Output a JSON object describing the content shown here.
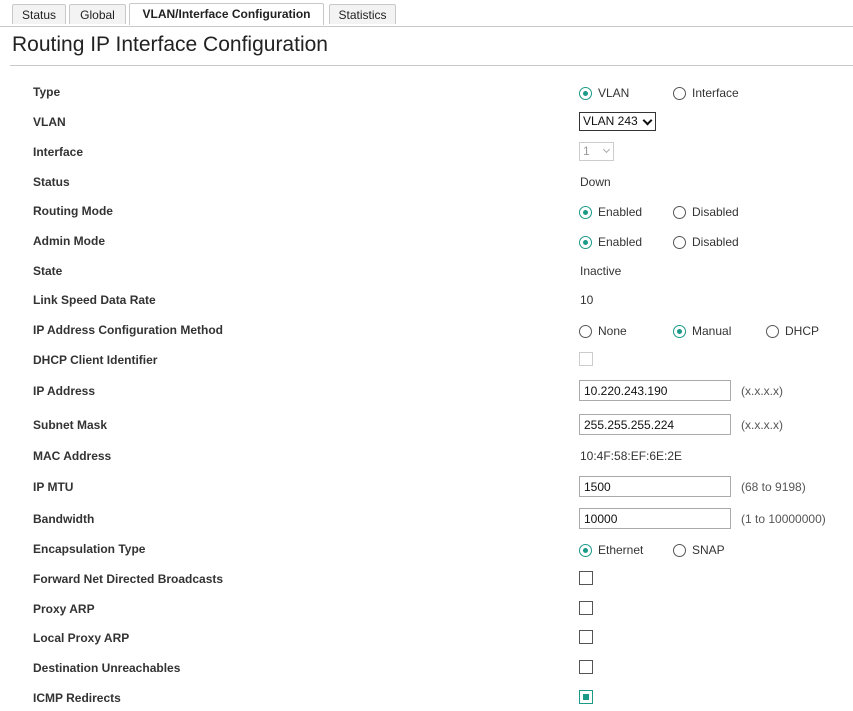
{
  "tabs": [
    "Status",
    "Global",
    "VLAN/Interface Configuration",
    "Statistics"
  ],
  "page_title": "Routing IP Interface Configuration",
  "fields": {
    "type": {
      "label": "Type",
      "options": [
        "VLAN",
        "Interface"
      ],
      "selected": "VLAN"
    },
    "vlan": {
      "label": "VLAN",
      "value": "VLAN 243"
    },
    "interface": {
      "label": "Interface",
      "value": "1"
    },
    "status": {
      "label": "Status",
      "value": "Down"
    },
    "routing_mode": {
      "label": "Routing Mode",
      "options": [
        "Enabled",
        "Disabled"
      ],
      "selected": "Enabled"
    },
    "admin_mode": {
      "label": "Admin Mode",
      "options": [
        "Enabled",
        "Disabled"
      ],
      "selected": "Enabled"
    },
    "state": {
      "label": "State",
      "value": "Inactive"
    },
    "link_speed": {
      "label": "Link Speed Data Rate",
      "value": "10"
    },
    "ip_method": {
      "label": "IP Address Configuration Method",
      "options": [
        "None",
        "Manual",
        "DHCP"
      ],
      "selected": "Manual"
    },
    "dhcp_client_id": {
      "label": "DHCP Client Identifier",
      "checked": false
    },
    "ip_address": {
      "label": "IP Address",
      "value": "10.220.243.190",
      "hint": "(x.x.x.x)"
    },
    "subnet_mask": {
      "label": "Subnet Mask",
      "value": "255.255.255.224",
      "hint": "(x.x.x.x)"
    },
    "mac_address": {
      "label": "MAC Address",
      "value": "10:4F:58:EF:6E:2E"
    },
    "ip_mtu": {
      "label": "IP MTU",
      "value": "1500",
      "hint": "(68 to 9198)"
    },
    "bandwidth": {
      "label": "Bandwidth",
      "value": "10000",
      "hint": "(1 to 10000000)"
    },
    "encapsulation": {
      "label": "Encapsulation Type",
      "options": [
        "Ethernet",
        "SNAP"
      ],
      "selected": "Ethernet"
    },
    "fwd_net_bcast": {
      "label": "Forward Net Directed Broadcasts",
      "checked": false
    },
    "proxy_arp": {
      "label": "Proxy ARP",
      "checked": false
    },
    "local_proxy_arp": {
      "label": "Local Proxy ARP",
      "checked": false
    },
    "dest_unreach": {
      "label": "Destination Unreachables",
      "checked": false
    },
    "icmp_redirects": {
      "label": "ICMP Redirects",
      "checked": true
    }
  },
  "colors": {
    "accent": "#1a9a87",
    "border": "#c9c9c9"
  }
}
